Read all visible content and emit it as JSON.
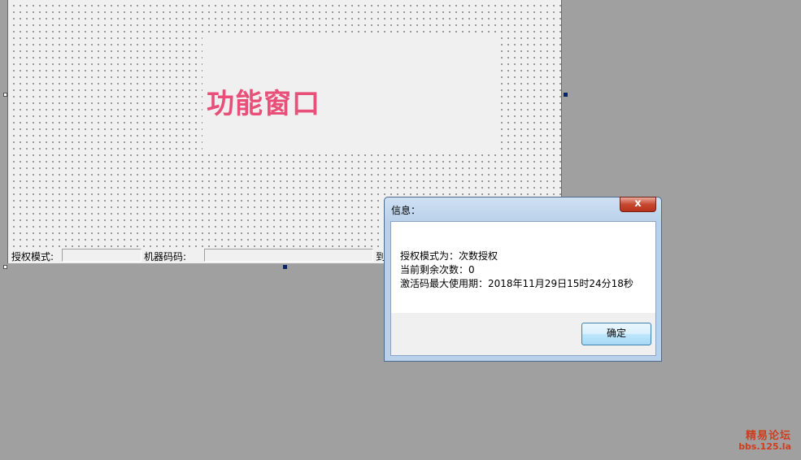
{
  "form": {
    "function_title": "功能窗口",
    "statusbar": {
      "auth_mode_label": "授权模式:",
      "machine_code_label": "机器码码:",
      "expire_label": "到"
    }
  },
  "dialog": {
    "title": "信息：",
    "close_glyph": "x",
    "lines": [
      "授权模式为：次数授权",
      "当前剩余次数：0",
      "激活码最大使用期：2018年11月29日15时24分18秒"
    ],
    "ok_label": "确定"
  },
  "watermark": {
    "line1": "精易论坛",
    "line2": "bbs.125.la"
  },
  "colors": {
    "desktop": "#a0a0a0",
    "title_pink": "#e8507a",
    "close_red": "#c7472f",
    "watermark": "#d23c1e"
  }
}
